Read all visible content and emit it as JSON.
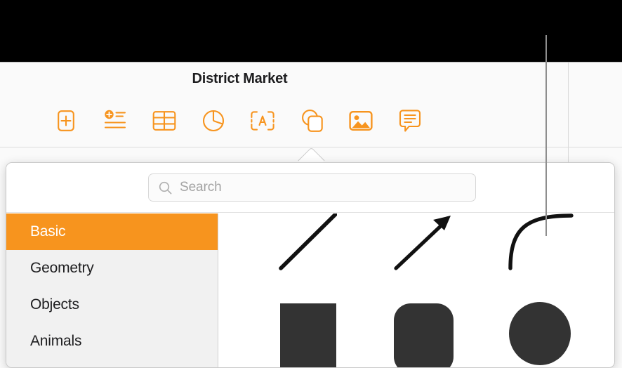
{
  "window": {
    "document_title": "District Market",
    "background_color": "#fafafa",
    "top_strip_color": "#000000",
    "accent_color": "#F7941E"
  },
  "toolbar": {
    "items": [
      {
        "name": "add-slide-button",
        "icon": "plus-in-rounded-square-icon",
        "label": "Add Slide"
      },
      {
        "name": "add-text-list-button",
        "icon": "bulleted-list-plus-icon",
        "label": "Text"
      },
      {
        "name": "insert-table-button",
        "icon": "table-grid-icon",
        "label": "Table"
      },
      {
        "name": "insert-chart-button",
        "icon": "pie-chart-icon",
        "label": "Chart"
      },
      {
        "name": "insert-text-box-button",
        "icon": "text-box-a-icon",
        "label": "Text Box"
      },
      {
        "name": "insert-shape-button",
        "icon": "shapes-overlap-icon",
        "label": "Shape"
      },
      {
        "name": "insert-media-button",
        "icon": "image-photo-icon",
        "label": "Media"
      },
      {
        "name": "insert-comment-button",
        "icon": "comment-bubble-icon",
        "label": "Comment"
      }
    ]
  },
  "shape_popover": {
    "search": {
      "placeholder": "Search",
      "value": "",
      "icon": "search-magnifier-icon"
    },
    "categories": [
      {
        "label": "Basic",
        "selected": true
      },
      {
        "label": "Geometry",
        "selected": false
      },
      {
        "label": "Objects",
        "selected": false
      },
      {
        "label": "Animals",
        "selected": false
      }
    ],
    "shapes": [
      {
        "name": "shape-line",
        "label": "Line",
        "icon": "diagonal-line-icon"
      },
      {
        "name": "shape-arrow",
        "label": "Arrow",
        "icon": "diagonal-arrow-icon"
      },
      {
        "name": "shape-curved-line",
        "label": "Curved Line",
        "icon": "quarter-arc-curve-icon"
      },
      {
        "name": "shape-square",
        "label": "Square",
        "icon": "filled-square-icon"
      },
      {
        "name": "shape-rounded-square",
        "label": "Rounded Square",
        "icon": "filled-rounded-square-icon"
      },
      {
        "name": "shape-circle",
        "label": "Circle",
        "icon": "filled-circle-icon"
      }
    ]
  },
  "annotation": {
    "callout_line_color": "#8e8e8e"
  }
}
